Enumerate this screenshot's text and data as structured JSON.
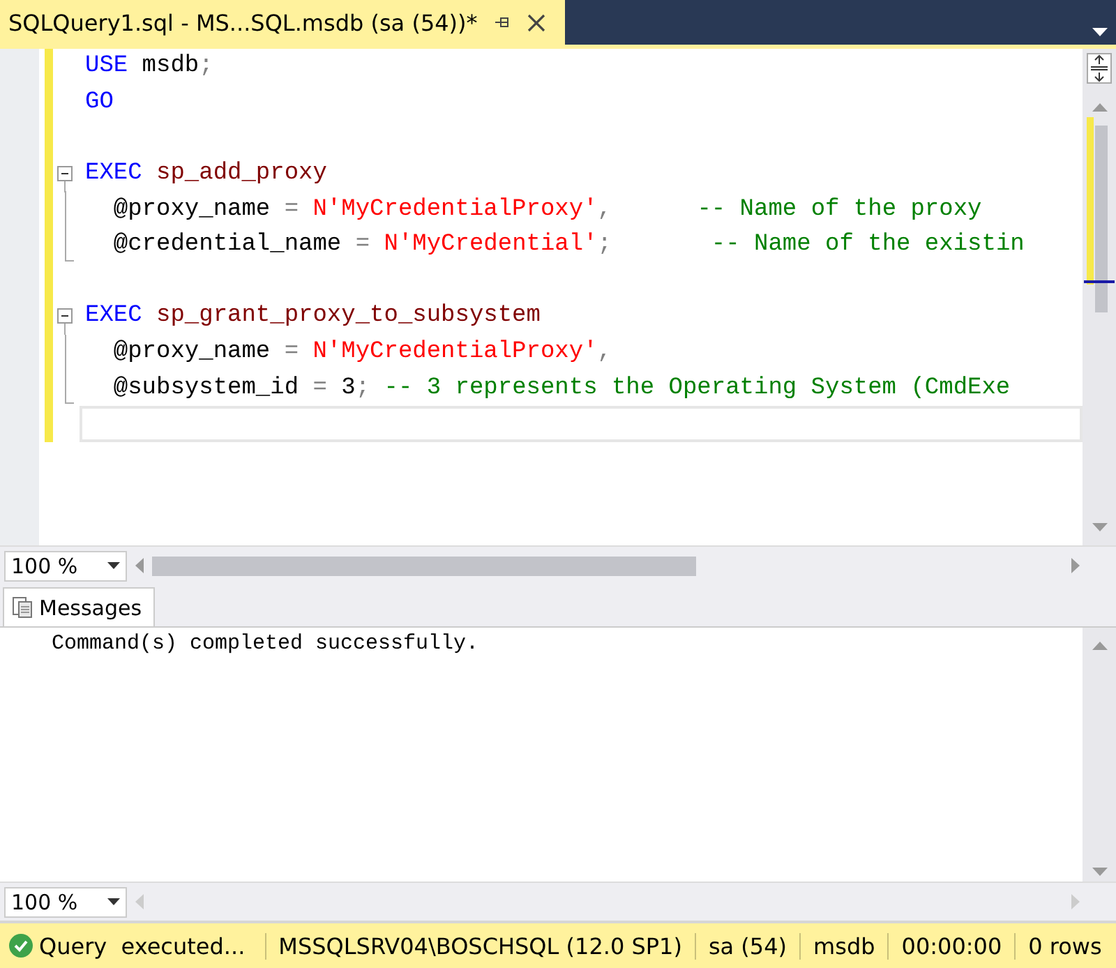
{
  "tab": {
    "title": "SQLQuery1.sql - MS...SQL.msdb (sa (54))*"
  },
  "editor": {
    "lines": [
      {
        "kind": "plain",
        "current": false,
        "tokens": [
          {
            "kind": "keyword",
            "text": "USE"
          },
          {
            "kind": "plain",
            "text": " msdb"
          },
          {
            "kind": "punct",
            "text": ";"
          }
        ]
      },
      {
        "kind": "plain",
        "current": false,
        "tokens": [
          {
            "kind": "keyword",
            "text": "GO"
          }
        ]
      },
      {
        "kind": "plain",
        "current": false
      },
      {
        "kind": "fold-start",
        "current": false,
        "tokens": [
          {
            "kind": "keyword",
            "text": "EXEC "
          },
          {
            "kind": "proc",
            "text": "sp_add_proxy"
          }
        ]
      },
      {
        "kind": "fold-inner",
        "current": false,
        "tokens": [
          {
            "kind": "plain",
            "text": "  @proxy_name "
          },
          {
            "kind": "punct",
            "text": "= "
          },
          {
            "kind": "string",
            "text": "N'MyCredentialProxy'"
          },
          {
            "kind": "punct",
            "text": ",      "
          },
          {
            "kind": "comment",
            "text": "-- Name of the proxy"
          }
        ]
      },
      {
        "kind": "fold-end",
        "current": false,
        "tokens": [
          {
            "kind": "plain",
            "text": "  @credential_name "
          },
          {
            "kind": "punct",
            "text": "= "
          },
          {
            "kind": "string",
            "text": "N'MyCredential'"
          },
          {
            "kind": "punct",
            "text": ";       "
          },
          {
            "kind": "comment",
            "text": "-- Name of the existin"
          }
        ]
      },
      {
        "kind": "plain",
        "current": false
      },
      {
        "kind": "fold-start",
        "current": false,
        "tokens": [
          {
            "kind": "keyword",
            "text": "EXEC "
          },
          {
            "kind": "proc",
            "text": "sp_grant_proxy_to_subsystem"
          }
        ]
      },
      {
        "kind": "fold-inner",
        "current": false,
        "tokens": [
          {
            "kind": "plain",
            "text": "  @proxy_name "
          },
          {
            "kind": "punct",
            "text": "= "
          },
          {
            "kind": "string",
            "text": "N'MyCredentialProxy'"
          },
          {
            "kind": "punct",
            "text": ","
          }
        ]
      },
      {
        "kind": "fold-end",
        "current": false,
        "tokens": [
          {
            "kind": "plain",
            "text": "  @subsystem_id "
          },
          {
            "kind": "punct",
            "text": "= "
          },
          {
            "kind": "plain",
            "text": "3"
          },
          {
            "kind": "punct",
            "text": "; "
          },
          {
            "kind": "comment",
            "text": "-- 3 represents the Operating System (CmdExe"
          }
        ]
      },
      {
        "kind": "plain",
        "current": true
      }
    ]
  },
  "editor_zoom": "100 %",
  "results_tabs": [
    {
      "label": "Messages",
      "selected": true
    }
  ],
  "messages": [
    "Command(s) completed successfully."
  ],
  "messages_zoom": "100 %",
  "status_bar": {
    "message": "Query  executed...",
    "items": [
      "MSSQLSRV04\\BOSCHSQL (12.0 SP1)",
      "sa (54)",
      "msdb",
      "00:00:00",
      "0 rows"
    ]
  }
}
